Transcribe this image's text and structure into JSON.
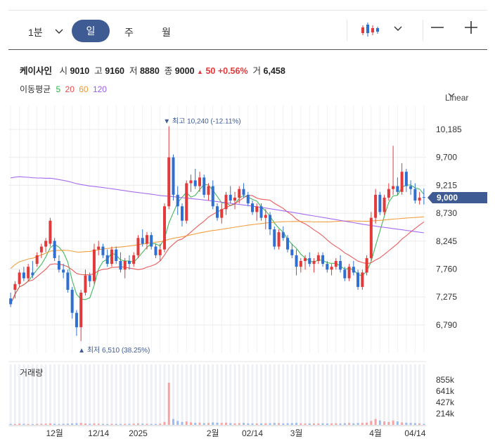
{
  "toolbar": {
    "interval": "1분",
    "tabs": [
      "일",
      "주",
      "월"
    ],
    "active_tab": "일",
    "zoom_out": "—",
    "zoom_in": "+"
  },
  "quote": {
    "name": "케이사인",
    "open_label": "시",
    "open": "9010",
    "high_label": "고",
    "high": "9160",
    "low_label": "저",
    "low": "8880",
    "close_label": "종",
    "close": "9000",
    "change": "50",
    "change_pct": "+0.56%",
    "volume_label": "거",
    "volume": "6,458"
  },
  "ma_legend": {
    "label": "이동평균",
    "periods": [
      {
        "p": "5",
        "color": "#2db34a"
      },
      {
        "p": "20",
        "color": "#e84c4c"
      },
      {
        "p": "60",
        "color": "#f0962e"
      },
      {
        "p": "120",
        "color": "#9d5cf0"
      }
    ]
  },
  "scale_mode": "Linear",
  "volume_title": "거래량",
  "colors": {
    "up": "#e2393b",
    "down": "#2f6fd1",
    "accent": "#3f5b94"
  },
  "chart_data": {
    "type": "candlestick",
    "y_ticks": [
      "10,185",
      "9,700",
      "9,215",
      "8,730",
      "8,245",
      "7,760",
      "7,275",
      "6,790"
    ],
    "y_range": [
      6300,
      10600
    ],
    "current_price_label": "9,000",
    "current_price": 9000,
    "high_annotation": "최고 10,240 (-12.11%)",
    "high_value": 10240,
    "low_annotation": "최저 6,510 (38.25%)",
    "low_value": 6510,
    "x_labels": [
      {
        "t": "12월",
        "i": 10
      },
      {
        "t": "12/14",
        "i": 20
      },
      {
        "t": "2025",
        "i": 29
      },
      {
        "t": "2월",
        "i": 46
      },
      {
        "t": "02/14",
        "i": 55
      },
      {
        "t": "3월",
        "i": 65
      },
      {
        "t": "4월",
        "i": 83
      },
      {
        "t": "04/14",
        "i": 92
      }
    ],
    "volume_ticks": [
      "855k",
      "641k",
      "427k",
      "214k"
    ],
    "candles": [
      [
        7250,
        7350,
        7100,
        7150
      ],
      [
        7400,
        7550,
        7250,
        7500
      ],
      [
        7500,
        7750,
        7450,
        7700
      ],
      [
        7700,
        7800,
        7550,
        7600
      ],
      [
        7600,
        7850,
        7550,
        7800
      ],
      [
        7700,
        7900,
        7600,
        7650
      ],
      [
        7850,
        8050,
        7800,
        8000
      ],
      [
        8050,
        8200,
        7950,
        8150
      ],
      [
        8150,
        8300,
        8050,
        8250
      ],
      [
        8200,
        8650,
        8150,
        8600
      ],
      [
        8250,
        8300,
        7900,
        7950
      ],
      [
        7900,
        8000,
        7700,
        7750
      ],
      [
        7750,
        7850,
        7600,
        7700
      ],
      [
        7700,
        7750,
        7350,
        7400
      ],
      [
        7400,
        7450,
        6900,
        7000
      ],
      [
        7000,
        7050,
        6600,
        6750
      ],
      [
        6750,
        7400,
        6510,
        7350
      ],
      [
        7350,
        7750,
        7300,
        7650
      ],
      [
        7650,
        7700,
        7450,
        7550
      ],
      [
        7550,
        8200,
        7500,
        8100
      ],
      [
        8100,
        8250,
        8000,
        8150
      ],
      [
        8150,
        8200,
        7950,
        8000
      ],
      [
        8000,
        8100,
        7800,
        7850
      ],
      [
        7850,
        8150,
        7800,
        8100
      ],
      [
        8100,
        8150,
        7850,
        7900
      ],
      [
        7900,
        8050,
        7700,
        7750
      ],
      [
        7750,
        7950,
        7600,
        7900
      ],
      [
        7900,
        8000,
        7750,
        7850
      ],
      [
        7850,
        8050,
        7800,
        8000
      ],
      [
        8000,
        8350,
        7950,
        8300
      ],
      [
        8300,
        8450,
        8150,
        8200
      ],
      [
        8200,
        8400,
        8100,
        8350
      ],
      [
        8350,
        8400,
        8100,
        8150
      ],
      [
        8150,
        8200,
        7950,
        8000
      ],
      [
        8000,
        8200,
        7900,
        8100
      ],
      [
        8100,
        8900,
        8050,
        8850
      ],
      [
        8850,
        10240,
        8800,
        9700
      ],
      [
        9700,
        9750,
        8950,
        9050
      ],
      [
        9050,
        9200,
        8700,
        8850
      ],
      [
        8850,
        8900,
        8500,
        8600
      ],
      [
        8600,
        9300,
        8550,
        9250
      ],
      [
        9250,
        9400,
        9100,
        9300
      ],
      [
        9300,
        9500,
        9150,
        9200
      ],
      [
        9200,
        9450,
        9100,
        9350
      ],
      [
        9350,
        9400,
        9000,
        9050
      ],
      [
        9050,
        9250,
        8950,
        9200
      ],
      [
        9200,
        9300,
        8800,
        8850
      ],
      [
        8850,
        8900,
        8600,
        8650
      ],
      [
        8650,
        8900,
        8550,
        8800
      ],
      [
        8800,
        9100,
        8700,
        9050
      ],
      [
        9050,
        9200,
        8900,
        8950
      ],
      [
        8950,
        9100,
        8800,
        9000
      ],
      [
        9000,
        9200,
        8900,
        9150
      ],
      [
        9150,
        9250,
        9000,
        9050
      ],
      [
        9050,
        9100,
        8850,
        8900
      ],
      [
        8900,
        8950,
        8700,
        8750
      ],
      [
        8750,
        8900,
        8600,
        8850
      ],
      [
        8850,
        8900,
        8600,
        8650
      ],
      [
        8650,
        8800,
        8450,
        8700
      ],
      [
        8700,
        8750,
        8350,
        8450
      ],
      [
        8450,
        8500,
        8100,
        8150
      ],
      [
        8150,
        8450,
        8100,
        8400
      ],
      [
        8400,
        8500,
        8250,
        8300
      ],
      [
        8300,
        8350,
        8050,
        8100
      ],
      [
        8100,
        8200,
        7950,
        8000
      ],
      [
        8000,
        8100,
        7650,
        7800
      ],
      [
        7800,
        7950,
        7700,
        7900
      ],
      [
        7900,
        8000,
        7750,
        7950
      ],
      [
        7950,
        8050,
        7800,
        7850
      ],
      [
        7850,
        7950,
        7700,
        7900
      ],
      [
        7900,
        8050,
        7850,
        8000
      ],
      [
        8000,
        8050,
        7800,
        7850
      ],
      [
        7850,
        7900,
        7700,
        7750
      ],
      [
        7750,
        7850,
        7650,
        7800
      ],
      [
        7800,
        7950,
        7750,
        7900
      ],
      [
        7900,
        8000,
        7700,
        7750
      ],
      [
        7750,
        7800,
        7550,
        7600
      ],
      [
        7600,
        7850,
        7550,
        7800
      ],
      [
        7800,
        7900,
        7650,
        7700
      ],
      [
        7700,
        7750,
        7400,
        7450
      ],
      [
        7450,
        7750,
        7400,
        7700
      ],
      [
        7700,
        8000,
        7650,
        7950
      ],
      [
        7950,
        8750,
        7900,
        8650
      ],
      [
        8650,
        9150,
        8550,
        9050
      ],
      [
        9050,
        9100,
        8700,
        8750
      ],
      [
        8750,
        9050,
        8700,
        9000
      ],
      [
        9000,
        9250,
        8950,
        9150
      ],
      [
        9150,
        9900,
        9050,
        9200
      ],
      [
        9200,
        9350,
        9050,
        9100
      ],
      [
        9100,
        9600,
        9050,
        9450
      ],
      [
        9450,
        9500,
        9100,
        9200
      ],
      [
        9200,
        9300,
        9050,
        9150
      ],
      [
        9150,
        9250,
        8900,
        8950
      ],
      [
        8950,
        9100,
        8880,
        9000
      ],
      [
        9010,
        9160,
        8880,
        9000
      ]
    ],
    "volumes": [
      20,
      18,
      25,
      22,
      18,
      15,
      20,
      22,
      25,
      30,
      20,
      18,
      22,
      25,
      30,
      35,
      40,
      28,
      22,
      30,
      25,
      20,
      18,
      22,
      20,
      18,
      20,
      22,
      25,
      30,
      25,
      22,
      20,
      18,
      25,
      60,
      855,
      120,
      80,
      60,
      70,
      50,
      40,
      45,
      35,
      40,
      50,
      45,
      40,
      45,
      35,
      30,
      35,
      40,
      30,
      30,
      28,
      30,
      32,
      35,
      40,
      35,
      30,
      32,
      35,
      40,
      30,
      28,
      30,
      28,
      30,
      32,
      28,
      30,
      32,
      28,
      35,
      40,
      32,
      38,
      40,
      45,
      80,
      120,
      90,
      70,
      60,
      90,
      70,
      50,
      45,
      40,
      35,
      30,
      20
    ]
  }
}
